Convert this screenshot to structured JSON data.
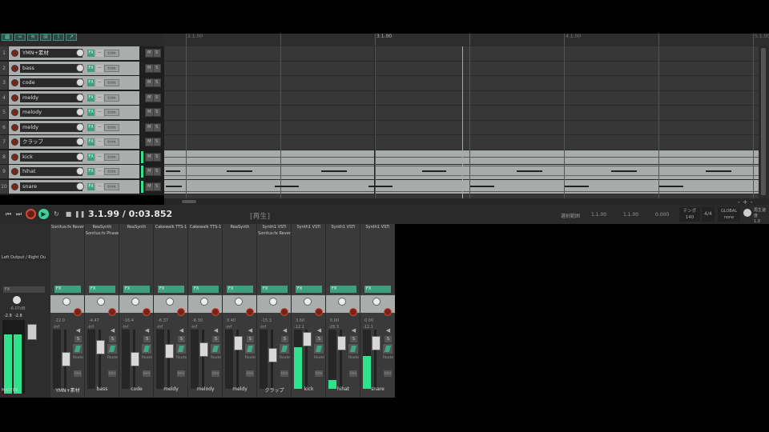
{
  "ruler": {
    "marks": [
      "",
      "2.1.00",
      "",
      "3.1.00",
      "",
      "4.1.00",
      "",
      "",
      "5.1.00"
    ]
  },
  "tracks": [
    {
      "num": "1",
      "name": "YMN+素材"
    },
    {
      "num": "2",
      "name": "bass"
    },
    {
      "num": "3",
      "name": "code"
    },
    {
      "num": "4",
      "name": "meldy"
    },
    {
      "num": "5",
      "name": "melody"
    },
    {
      "num": "6",
      "name": "meldy"
    },
    {
      "num": "7",
      "name": "クラップ"
    },
    {
      "num": "8",
      "name": "kick"
    },
    {
      "num": "9",
      "name": "hihat"
    },
    {
      "num": "10",
      "name": "snare"
    }
  ],
  "track_buttons": {
    "fx": "FX",
    "trim": "—",
    "env": "trim",
    "mute": "M",
    "solo": "S"
  },
  "transport": {
    "time": "3.1.99 / 0:03.852",
    "status": "[再生]",
    "selection_label": "選択範囲",
    "sel_start": "1.1.00",
    "sel_end": "1.1.00",
    "sel_len": "0.000",
    "bpm_label": "テンポ",
    "bpm": "140",
    "timesig": "4/4",
    "global_label": "GLOBAL",
    "global_value": "none",
    "rate_label": "再生速度",
    "rate_value": "1.0"
  },
  "master": {
    "routing": "Left Output / Right Ou",
    "volume": "-6.07dB",
    "peak_l": "-2.8",
    "peak_r": "-2.8",
    "label": "MASTER"
  },
  "strips": [
    {
      "fx1": "Sonitus:fx Rever",
      "fx2": "",
      "vol": "-22.0",
      "peak": "-inf",
      "label": "YMN+素材",
      "level": 0
    },
    {
      "fx1": "ReaSynth",
      "fx2": "Sonitus:fx Phase",
      "vol": "-4.47",
      "peak": "-inf",
      "label": "bass",
      "level": 0
    },
    {
      "fx1": "ReaSynth",
      "fx2": "",
      "vol": "-16.4",
      "peak": "-inf",
      "label": "code",
      "level": 0
    },
    {
      "fx1": "Cakewalk TTS-1",
      "fx2": "",
      "vol": "-8.37",
      "peak": "-inf",
      "label": "meldy",
      "level": 0
    },
    {
      "fx1": "Cakewalk TTS-1",
      "fx2": "",
      "vol": "-6.30",
      "peak": "-inf",
      "label": "melody",
      "level": 0
    },
    {
      "fx1": "ReaSynth",
      "fx2": "",
      "vol": "0.40",
      "peak": "-inf",
      "label": "meldy",
      "level": 0
    },
    {
      "fx1": "Synth1 VSTi",
      "fx2": "Sonitus:fx Rever",
      "vol": "-15.3",
      "peak": "-inf",
      "label": "クラップ",
      "level": 0
    },
    {
      "fx1": "Synth1 VSTi",
      "fx2": "",
      "vol": "3.60",
      "peak": "-12.1",
      "label": "kick",
      "level": 0.7
    },
    {
      "fx1": "Synth1 VSTi",
      "fx2": "",
      "vol": "0.00",
      "peak": "-28.3",
      "label": "hihat",
      "level": 0.15
    },
    {
      "fx1": "Synth1 VSTi",
      "fx2": "",
      "vol": "0.00",
      "peak": "-12.1",
      "label": "snare",
      "level": 0.55
    }
  ],
  "strip_buttons": {
    "fx": "FX",
    "mute": "◀",
    "solo": "S",
    "route": "Route",
    "trim": "trim"
  },
  "colors": {
    "accent": "#3fd197",
    "meter": "#2fe38c",
    "record": "#d04b38",
    "playhead": "#c6a95a"
  }
}
